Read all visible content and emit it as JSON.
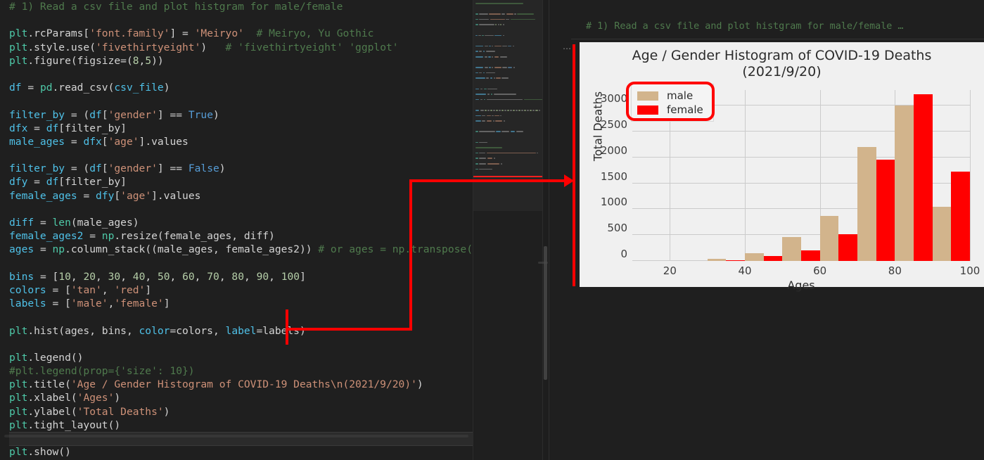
{
  "editor": {
    "code_lines": [
      [
        {
          "t": "# 1) Read a csv file and plot histgram for male/female",
          "c": "cm"
        }
      ],
      [],
      [
        {
          "t": "plt",
          "c": "fn"
        },
        {
          "t": ".rcParams[",
          "c": "pun"
        },
        {
          "t": "'font.family'",
          "c": "str"
        },
        {
          "t": "] = ",
          "c": "pun"
        },
        {
          "t": "'Meiryo'",
          "c": "str"
        },
        {
          "t": "  ",
          "c": "pun"
        },
        {
          "t": "# Meiryo, Yu Gothic",
          "c": "cm"
        }
      ],
      [
        {
          "t": "plt",
          "c": "fn"
        },
        {
          "t": ".style.use(",
          "c": "pun"
        },
        {
          "t": "'fivethirtyeight'",
          "c": "str"
        },
        {
          "t": ")   ",
          "c": "pun"
        },
        {
          "t": "# 'fivethirtyeight' 'ggplot'",
          "c": "cm"
        }
      ],
      [
        {
          "t": "plt",
          "c": "fn"
        },
        {
          "t": ".figure(figsize=(",
          "c": "pun"
        },
        {
          "t": "8",
          "c": "num"
        },
        {
          "t": ",",
          "c": "pun"
        },
        {
          "t": "5",
          "c": "num"
        },
        {
          "t": "))",
          "c": "pun"
        }
      ],
      [],
      [
        {
          "t": "df",
          "c": "kwblue"
        },
        {
          "t": " = ",
          "c": "pun"
        },
        {
          "t": "pd",
          "c": "fn"
        },
        {
          "t": ".read_csv(",
          "c": "pun"
        },
        {
          "t": "csv_file",
          "c": "kwblue"
        },
        {
          "t": ")",
          "c": "pun"
        }
      ],
      [],
      [
        {
          "t": "filter_by",
          "c": "kwblue"
        },
        {
          "t": " = (",
          "c": "pun"
        },
        {
          "t": "df",
          "c": "kwblue"
        },
        {
          "t": "[",
          "c": "pun"
        },
        {
          "t": "'gender'",
          "c": "str"
        },
        {
          "t": "] == ",
          "c": "pun"
        },
        {
          "t": "True",
          "c": "bool"
        },
        {
          "t": ")",
          "c": "pun"
        }
      ],
      [
        {
          "t": "dfx",
          "c": "kwblue"
        },
        {
          "t": " = ",
          "c": "pun"
        },
        {
          "t": "df",
          "c": "kwblue"
        },
        {
          "t": "[filter_by]",
          "c": "pun"
        }
      ],
      [
        {
          "t": "male_ages",
          "c": "kwblue"
        },
        {
          "t": " = ",
          "c": "pun"
        },
        {
          "t": "dfx",
          "c": "kwblue"
        },
        {
          "t": "[",
          "c": "pun"
        },
        {
          "t": "'age'",
          "c": "str"
        },
        {
          "t": "].values",
          "c": "pun"
        }
      ],
      [],
      [
        {
          "t": "filter_by",
          "c": "kwblue"
        },
        {
          "t": " = (",
          "c": "pun"
        },
        {
          "t": "df",
          "c": "kwblue"
        },
        {
          "t": "[",
          "c": "pun"
        },
        {
          "t": "'gender'",
          "c": "str"
        },
        {
          "t": "] == ",
          "c": "pun"
        },
        {
          "t": "False",
          "c": "bool"
        },
        {
          "t": ")",
          "c": "pun"
        }
      ],
      [
        {
          "t": "dfy",
          "c": "kwblue"
        },
        {
          "t": " = ",
          "c": "pun"
        },
        {
          "t": "df",
          "c": "kwblue"
        },
        {
          "t": "[filter_by]",
          "c": "pun"
        }
      ],
      [
        {
          "t": "female_ages",
          "c": "kwblue"
        },
        {
          "t": " = ",
          "c": "pun"
        },
        {
          "t": "dfy",
          "c": "kwblue"
        },
        {
          "t": "[",
          "c": "pun"
        },
        {
          "t": "'age'",
          "c": "str"
        },
        {
          "t": "].values",
          "c": "pun"
        }
      ],
      [],
      [
        {
          "t": "diff",
          "c": "kwblue"
        },
        {
          "t": " = ",
          "c": "pun"
        },
        {
          "t": "len",
          "c": "fn"
        },
        {
          "t": "(male_ages)",
          "c": "pun"
        }
      ],
      [
        {
          "t": "female_ages2",
          "c": "kwblue"
        },
        {
          "t": " = ",
          "c": "pun"
        },
        {
          "t": "np",
          "c": "fn"
        },
        {
          "t": ".resize(female_ages, diff)",
          "c": "pun"
        }
      ],
      [
        {
          "t": "ages",
          "c": "kwblue"
        },
        {
          "t": " = ",
          "c": "pun"
        },
        {
          "t": "np",
          "c": "fn"
        },
        {
          "t": ".column_stack((male_ages, female_ages2)) ",
          "c": "pun"
        },
        {
          "t": "# or ages = np.transpose((mages, fag",
          "c": "cm"
        }
      ],
      [],
      [
        {
          "t": "bins",
          "c": "kwblue"
        },
        {
          "t": " = [",
          "c": "pun"
        },
        {
          "t": "10",
          "c": "num"
        },
        {
          "t": ", ",
          "c": "pun"
        },
        {
          "t": "20",
          "c": "num"
        },
        {
          "t": ", ",
          "c": "pun"
        },
        {
          "t": "30",
          "c": "num"
        },
        {
          "t": ", ",
          "c": "pun"
        },
        {
          "t": "40",
          "c": "num"
        },
        {
          "t": ", ",
          "c": "pun"
        },
        {
          "t": "50",
          "c": "num"
        },
        {
          "t": ", ",
          "c": "pun"
        },
        {
          "t": "60",
          "c": "num"
        },
        {
          "t": ", ",
          "c": "pun"
        },
        {
          "t": "70",
          "c": "num"
        },
        {
          "t": ", ",
          "c": "pun"
        },
        {
          "t": "80",
          "c": "num"
        },
        {
          "t": ", ",
          "c": "pun"
        },
        {
          "t": "90",
          "c": "num"
        },
        {
          "t": ", ",
          "c": "pun"
        },
        {
          "t": "100",
          "c": "num"
        },
        {
          "t": "]",
          "c": "pun"
        }
      ],
      [
        {
          "t": "colors",
          "c": "kwblue"
        },
        {
          "t": " = [",
          "c": "pun"
        },
        {
          "t": "'tan'",
          "c": "str"
        },
        {
          "t": ", ",
          "c": "pun"
        },
        {
          "t": "'red'",
          "c": "str"
        },
        {
          "t": "]",
          "c": "pun"
        }
      ],
      [
        {
          "t": "labels",
          "c": "kwblue"
        },
        {
          "t": " = [",
          "c": "pun"
        },
        {
          "t": "'male'",
          "c": "str"
        },
        {
          "t": ",",
          "c": "pun"
        },
        {
          "t": "'female'",
          "c": "str"
        },
        {
          "t": "]",
          "c": "pun"
        }
      ],
      [],
      [
        {
          "t": "plt",
          "c": "fn"
        },
        {
          "t": ".hist(ages, bins, ",
          "c": "pun"
        },
        {
          "t": "color",
          "c": "kwblue"
        },
        {
          "t": "=colors, ",
          "c": "pun"
        },
        {
          "t": "label",
          "c": "kwblue"
        },
        {
          "t": "=labels)",
          "c": "pun"
        }
      ],
      [],
      [
        {
          "t": "plt",
          "c": "fn"
        },
        {
          "t": ".legend()",
          "c": "pun"
        }
      ],
      [
        {
          "t": "#plt.legend(prop={'size': 10})",
          "c": "cm"
        }
      ],
      [
        {
          "t": "plt",
          "c": "fn"
        },
        {
          "t": ".title(",
          "c": "pun"
        },
        {
          "t": "'Age / Gender Histogram of COVID-19 Deaths\\n(2021/9/20)'",
          "c": "str"
        },
        {
          "t": ")",
          "c": "pun"
        }
      ],
      [
        {
          "t": "plt",
          "c": "fn"
        },
        {
          "t": ".xlabel(",
          "c": "pun"
        },
        {
          "t": "'Ages'",
          "c": "str"
        },
        {
          "t": ")",
          "c": "pun"
        }
      ],
      [
        {
          "t": "plt",
          "c": "fn"
        },
        {
          "t": ".ylabel(",
          "c": "pun"
        },
        {
          "t": "'Total Deaths'",
          "c": "str"
        },
        {
          "t": ")",
          "c": "pun"
        }
      ],
      [
        {
          "t": "plt",
          "c": "fn"
        },
        {
          "t": ".tight_layout()",
          "c": "pun"
        }
      ],
      [],
      [
        {
          "t": "plt",
          "c": "fn"
        },
        {
          "t": ".show()",
          "c": "pun"
        }
      ]
    ],
    "current_line_index": 32
  },
  "output_panel": {
    "comment": "# 1) Read a csv file and plot histgram for male/female …",
    "collapse_dots": "⋯"
  },
  "chart_data": {
    "type": "bar",
    "title": "Age / Gender Histogram of COVID-19 Deaths\n(2021/9/20)",
    "xlabel": "Ages",
    "ylabel": "Total Deaths",
    "xlim": [
      10,
      100
    ],
    "ylim": [
      0,
      3300
    ],
    "yticks": [
      0,
      500,
      1000,
      1500,
      2000,
      2500,
      3000
    ],
    "xticks": [
      20,
      40,
      60,
      80,
      100
    ],
    "grid": true,
    "legend_position": "upper left",
    "bin_edges": [
      10,
      20,
      30,
      40,
      50,
      60,
      70,
      80,
      90,
      100
    ],
    "categories": [
      "10-20",
      "20-30",
      "30-40",
      "40-50",
      "50-60",
      "60-70",
      "70-80",
      "80-90",
      "90-100"
    ],
    "series": [
      {
        "name": "male",
        "color": "#d2b48c",
        "values": [
          0,
          0,
          45,
          155,
          465,
          875,
          2200,
          3000,
          1050
        ]
      },
      {
        "name": "female",
        "color": "#ff0000",
        "values": [
          0,
          0,
          20,
          90,
          200,
          520,
          1960,
          3220,
          1730
        ]
      }
    ],
    "legend": [
      {
        "label": "male",
        "color": "#d2b48c"
      },
      {
        "label": "female",
        "color": "#ff0000"
      }
    ]
  },
  "annotations": {
    "legend_highlight_color": "#ff0000",
    "arrow_color": "#ff0000",
    "arrow_description": "elbow arrow from plt.hist line to chart"
  }
}
